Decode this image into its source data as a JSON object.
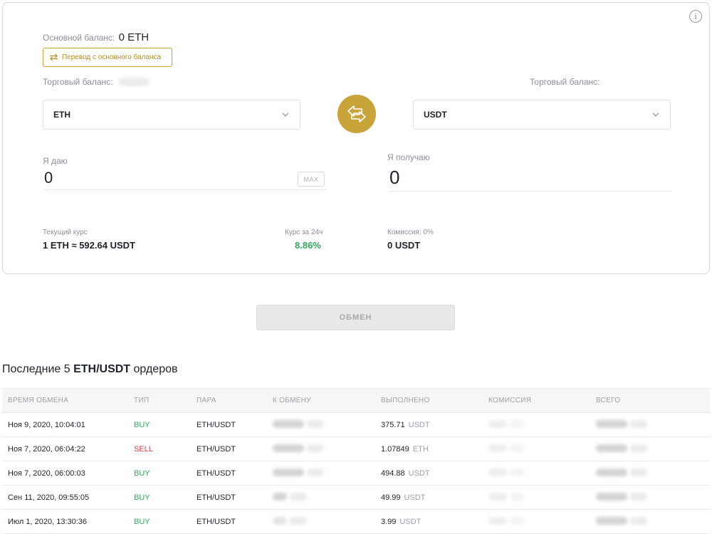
{
  "exchange": {
    "main_balance_label": "Основной баланс:",
    "main_balance_value": "0 ETH",
    "transfer_button_label": "Перевод с основного баланса",
    "trade_balance_label_left": "Торговый баланс:",
    "trade_balance_label_right": "Торговый баланс:",
    "from_currency": "ETH",
    "to_currency": "USDT",
    "give_label": "Я даю",
    "give_value": "0",
    "max_label": "MAX",
    "get_label": "Я получаю",
    "get_value": "0",
    "rate_label": "Текущий курс",
    "rate_value": "1 ETH ≈ 592.64 USDT",
    "change_label": "Курс за 24ч",
    "change_value": "8.86%",
    "fee_label": "Комиссия: 0%",
    "fee_value": "0 USDT",
    "exchange_button_label": "ОБМЕН",
    "info_icon": "i"
  },
  "colors": {
    "accent_gold": "#c9a43a",
    "buy_green": "#2eaa5c",
    "sell_red": "#e0444e"
  },
  "orders": {
    "title_prefix": "Последние 5 ",
    "title_pair": "ETH/USDT",
    "title_suffix": " ордеров",
    "headers": {
      "time": "ВРЕМЯ ОБМЕНА",
      "type": "ТИП",
      "pair": "ПАРА",
      "amount": "К ОБМЕНУ",
      "done": "ВЫПОЛНЕНО",
      "fee": "КОМИССИЯ",
      "total": "ВСЕГО"
    },
    "rows": [
      {
        "time": "Ноя 9, 2020, 10:04:01",
        "type": "BUY",
        "pair": "ETH/USDT",
        "done_value": "375.71",
        "done_unit": "USDT"
      },
      {
        "time": "Ноя 7, 2020, 06:04:22",
        "type": "SELL",
        "pair": "ETH/USDT",
        "done_value": "1.07849",
        "done_unit": "ETH"
      },
      {
        "time": "Ноя 7, 2020, 06:00:03",
        "type": "BUY",
        "pair": "ETH/USDT",
        "done_value": "494.88",
        "done_unit": "USDT"
      },
      {
        "time": "Сен 11, 2020, 09:55:05",
        "type": "BUY",
        "pair": "ETH/USDT",
        "done_value": "49.99",
        "done_unit": "USDT"
      },
      {
        "time": "Июл 1, 2020, 13:30:36",
        "type": "BUY",
        "pair": "ETH/USDT",
        "done_value": "3.99",
        "done_unit": "USDT"
      }
    ]
  }
}
